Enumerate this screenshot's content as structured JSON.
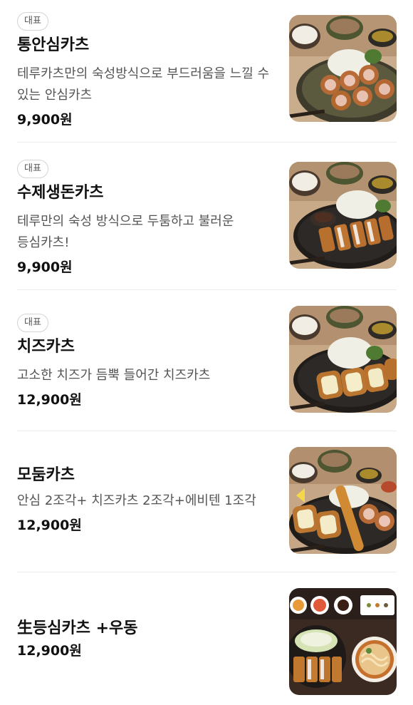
{
  "menu": {
    "items": [
      {
        "badge": "대표",
        "name": "통안심카츠",
        "description": "테루카츠만의 숙성방식으로 부드러움을 느낄 수 있는 안심카츠",
        "price": "9,900원",
        "image_icon": "tenderloin-katsu-plate-image"
      },
      {
        "badge": "대표",
        "name": "수제생돈카츠",
        "description": "테루만의 숙성 방식으로 두툼하고 불러운 등심카츠!",
        "price": "9,900원",
        "image_icon": "pork-loin-katsu-plate-image"
      },
      {
        "badge": "대표",
        "name": "치즈카츠",
        "description": "고소한 치즈가 듬뿍 들어간 치즈카츠",
        "price": "12,900원",
        "image_icon": "cheese-katsu-plate-image"
      },
      {
        "badge": "",
        "name": "모둠카츠",
        "description": "안심 2조각+ 치즈카츠 2조각+에비텐 1조각",
        "price": "12,900원",
        "image_icon": "assorted-katsu-plate-image"
      },
      {
        "badge": "",
        "name": "生등심카츠 +우동",
        "description": "",
        "price": "12,900원",
        "image_icon": "loin-katsu-udon-set-image"
      }
    ]
  },
  "colors": {
    "text_primary": "#111111",
    "text_secondary": "#555555",
    "badge_border": "#d4d4d4",
    "divider": "#ececec"
  }
}
